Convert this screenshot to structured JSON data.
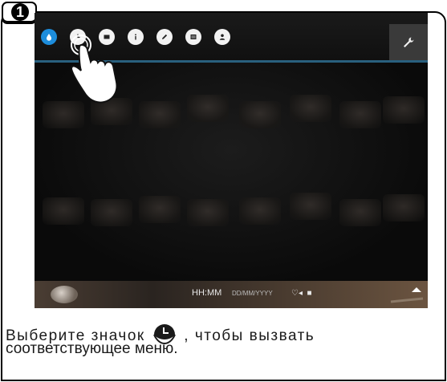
{
  "step": {
    "number": "1"
  },
  "toolbar": {
    "icons": [
      "drop-icon",
      "clock-icon",
      "screen-icon",
      "info-icon",
      "pencil-icon",
      "list-icon",
      "user-icon"
    ],
    "tools_icon": "wrench-icon",
    "accent": "#29607e",
    "active_icon_color": "#1d8ddc"
  },
  "status_bar": {
    "time": "HH:MM",
    "date": "DD/MM/YYYY"
  },
  "caption": {
    "line1_part1": "Выберите значок",
    "line1_part2": ", чтобы вызвать",
    "line2": "соответствующее меню."
  }
}
